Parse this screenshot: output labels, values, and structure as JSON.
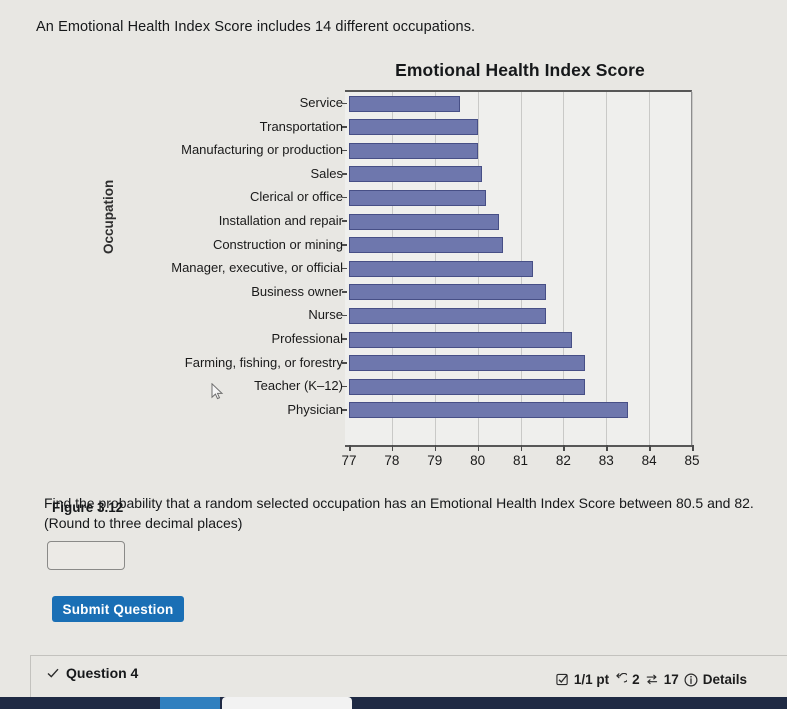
{
  "intro": {
    "text": "An Emotional Health Index Score includes 14 different occupations."
  },
  "chart_data": {
    "type": "bar",
    "orientation": "horizontal",
    "title": "Emotional Health Index Score",
    "xlabel": "",
    "ylabel": "Occupation",
    "xlim": [
      77,
      85
    ],
    "xticks": [
      77,
      78,
      79,
      80,
      81,
      82,
      83,
      84,
      85
    ],
    "grid": true,
    "legend": "none",
    "bar_color": "#6e77ad",
    "categories": [
      "Service",
      "Transportation",
      "Manufacturing or production",
      "Sales",
      "Clerical or office",
      "Installation and repair",
      "Construction or mining",
      "Manager, executive, or official",
      "Business owner",
      "Nurse",
      "Professional",
      "Farming, fishing, or forestry",
      "Teacher (K–12)",
      "Physician"
    ],
    "values": [
      79.6,
      80.0,
      80.0,
      80.1,
      80.2,
      80.5,
      80.6,
      81.3,
      81.6,
      81.6,
      82.2,
      82.5,
      82.5,
      83.5
    ]
  },
  "figure": {
    "caption": "Figure 3.12"
  },
  "question": {
    "prompt": "Find the probability that a random selected occupation has an Emotional Health Index Score between 80.5 and 82. (Round to three decimal places)",
    "answer_value": "",
    "answer_placeholder": "",
    "submit_label": "Submit Question"
  },
  "footer": {
    "question_label": "Question 4",
    "points": "1/1 pt",
    "retries": "2",
    "attempts": "17",
    "details_label": "Details",
    "icons": {
      "status": "check-icon",
      "points": "checkbox-checked-icon",
      "retries": "undo-arrow-icon",
      "attempts": "two-way-arrows-icon",
      "details": "info-circle-icon"
    }
  }
}
